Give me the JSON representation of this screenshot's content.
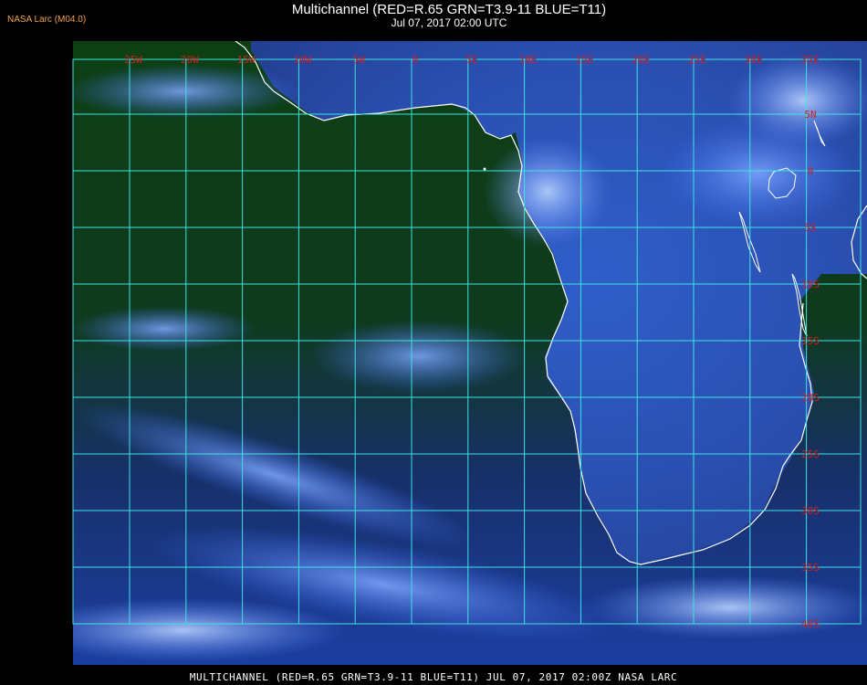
{
  "header": {
    "source_label": "NASA Larc (M04.0)",
    "title": "Multichannel (RED=R.65 GRN=T3.9-11 BLUE=T11)",
    "subtitle": "Jul 07, 2017 02:00 UTC"
  },
  "footer": {
    "caption": "MULTICHANNEL (RED=R.65 GRN=T3.9-11 BLUE=T11) JUL 07, 2017 02:00Z   NASA LARC"
  },
  "map": {
    "grid_color": "#3de3e3",
    "label_color": "#d21e1e",
    "coast_color": "#ffffff",
    "ocean_color": "#0c3a0c",
    "longitude_labels": [
      "25W",
      "20W",
      "15W",
      "10W",
      "5W",
      "0",
      "5E",
      "10E",
      "15E",
      "20E",
      "25E",
      "30E",
      "35E"
    ],
    "latitude_labels": [
      "5N",
      "0",
      "5S",
      "10S",
      "15S",
      "20S",
      "25S",
      "30S",
      "35S",
      "40S"
    ]
  }
}
